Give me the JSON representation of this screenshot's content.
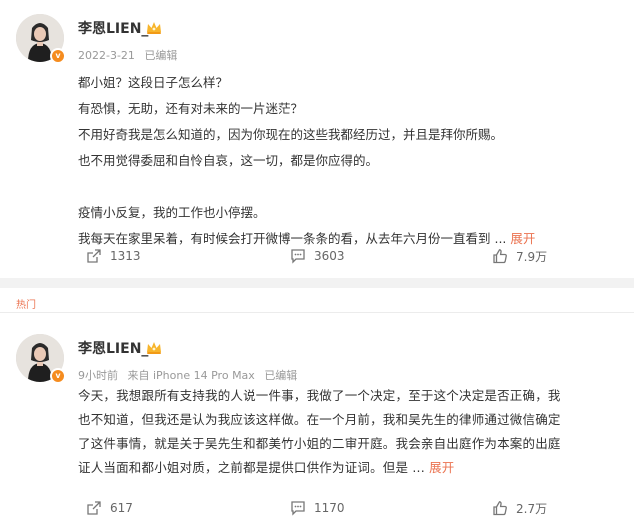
{
  "posts": [
    {
      "username": "李恩LIEN_",
      "time": "2022-3-21",
      "edited": "已编辑",
      "lines": [
        "都小姐？这段日子怎么样？",
        "有恐惧，无助，还有对未来的一片迷茫？",
        "不用好奇我是怎么知道的，因为你现在的这些我都经历过，并且是拜你所赐。",
        "也不用觉得委屈和自怜自哀，这一切，都是你应得的。",
        "",
        "疫情小反复，我的工作也小停摆。",
        "我每天在家里呆着，有时候会打开微博一条条的看，从去年六月份一直看到 ..."
      ],
      "expand": "展开",
      "reposts": "1313",
      "comments": "3603",
      "likes": "7.9万"
    },
    {
      "username": "李恩LIEN_",
      "time": "9小时前",
      "source": "来自 iPhone 14 Pro Max",
      "edited": "已编辑",
      "lines": [
        "今天，我想跟所有支持我的人说一件事，我做了一个决定，至于这个决定是否正确，我",
        "也不知道，但我还是认为我应该这样做。在一个月前，我和吴先生的律师通过微信确定",
        "了这件事情，就是关于吴先生和都美竹小姐的二审开庭。我会亲自出庭作为本案的出庭",
        "证人当面和都小姐对质，之前都是提供口供作为证词。但是 ..."
      ],
      "expand": "展开",
      "reposts": "617",
      "comments": "1170",
      "likes": "2.7万"
    }
  ],
  "section_label": "热门",
  "colors": {
    "accent": "#eb7350",
    "badge": "#f58c1f",
    "muted": "#999999",
    "text": "#333333"
  },
  "icons": {
    "repost": "repost-icon",
    "comment": "comment-icon",
    "like": "thumbs-up-icon",
    "verified": "verified-badge-icon",
    "crown": "crown-icon"
  }
}
